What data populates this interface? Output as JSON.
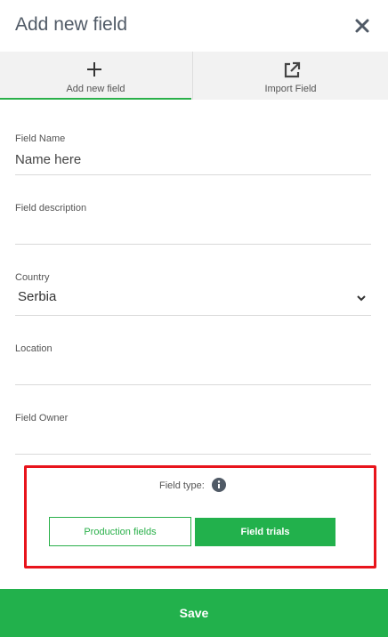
{
  "header": {
    "title": "Add new field"
  },
  "tabs": [
    {
      "label": "Add new field",
      "icon": "plus-icon",
      "active": true
    },
    {
      "label": "Import Field",
      "icon": "external-link-icon",
      "active": false
    }
  ],
  "form": {
    "field_name": {
      "label": "Field Name",
      "placeholder": "Name here",
      "value": ""
    },
    "field_description": {
      "label": "Field description",
      "value": ""
    },
    "country": {
      "label": "Country",
      "value": "Serbia"
    },
    "location": {
      "label": "Location",
      "value": ""
    },
    "field_owner": {
      "label": "Field Owner",
      "value": ""
    }
  },
  "field_type": {
    "label": "Field type:",
    "options": [
      {
        "label": "Production fields",
        "selected": false
      },
      {
        "label": "Field trials",
        "selected": true
      }
    ]
  },
  "footer": {
    "save_label": "Save"
  },
  "colors": {
    "accent": "#22b14c",
    "highlight": "#e8141c",
    "tab_bg": "#f2f2f2"
  }
}
